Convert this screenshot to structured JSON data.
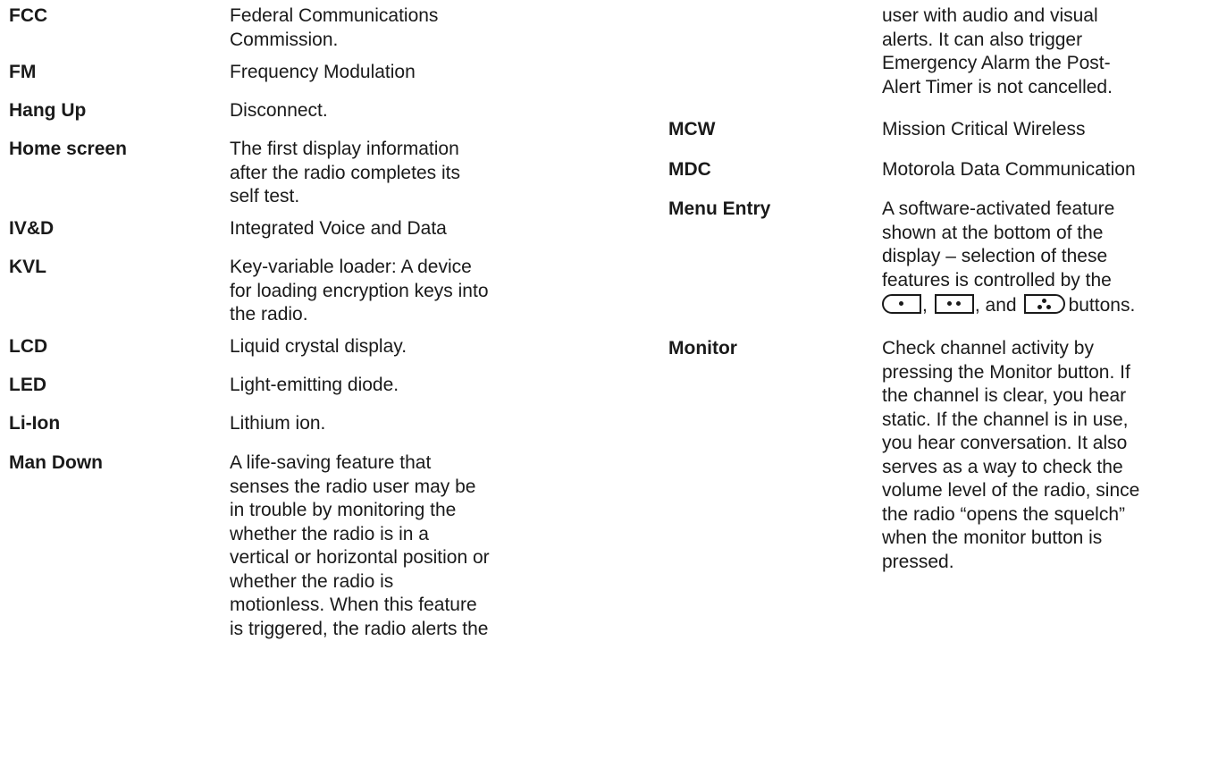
{
  "glossary_left": [
    {
      "term": "FCC",
      "definition_lines": [
        "Federal Communications",
        "Commission."
      ]
    },
    {
      "term": "FM",
      "definition_lines": [
        "Frequency Modulation"
      ]
    },
    {
      "term": "Hang Up",
      "definition_lines": [
        "Disconnect."
      ]
    },
    {
      "term": "Home screen",
      "definition_lines": [
        "The first display information",
        "after the radio completes its",
        "self test."
      ]
    },
    {
      "term": "IV&D",
      "definition_lines": [
        "Integrated Voice and Data"
      ]
    },
    {
      "term": "KVL",
      "definition_lines": [
        "Key-variable loader: A device",
        "for loading encryption keys into",
        "the radio."
      ]
    },
    {
      "term": "LCD",
      "definition_lines": [
        "Liquid crystal display."
      ]
    },
    {
      "term": "LED",
      "definition_lines": [
        "Light-emitting diode."
      ]
    },
    {
      "term": "Li-Ion",
      "definition_lines": [
        "Lithium ion."
      ]
    },
    {
      "term": "Man Down",
      "definition_lines": [
        "A life-saving feature that",
        "senses the radio user may be",
        "in trouble by monitoring the",
        "whether the radio is in a",
        "vertical or horizontal position or",
        "whether the radio is",
        "motionless. When this feature",
        "is triggered, the radio alerts the"
      ]
    }
  ],
  "glossary_right_continuation": [
    "user with audio and visual",
    "alerts. It can also trigger",
    "Emergency Alarm the Post-",
    "Alert Timer is not cancelled."
  ],
  "glossary_right": [
    {
      "term": "MCW",
      "definition_lines": [
        "Mission Critical Wireless"
      ]
    },
    {
      "term": "MDC",
      "definition_lines": [
        "Motorola Data Communication"
      ]
    },
    {
      "term": "Menu Entry",
      "definition_lines": [
        "A software-activated feature",
        "shown at the bottom of the",
        "display – selection of these",
        "features is controlled by the"
      ]
    },
    {
      "term": "Monitor",
      "definition_lines": [
        "Check channel activity by",
        "pressing the Monitor button. If",
        "the channel is clear, you hear",
        "static. If the channel is in use,",
        "you hear conversation. It also",
        "serves as a way to check the",
        "volume level of the radio, since",
        "the radio “opens the squelch”",
        "when the monitor button is",
        "pressed."
      ]
    }
  ],
  "menu_entry_buttons": {
    "icons": [
      "menu-select-left-button-icon",
      "menu-select-center-button-icon",
      "menu-select-right-button-icon"
    ],
    "sep_comma_1": ",",
    "sep_comma_2": ",",
    "sep_and": "and",
    "tail": "buttons."
  }
}
